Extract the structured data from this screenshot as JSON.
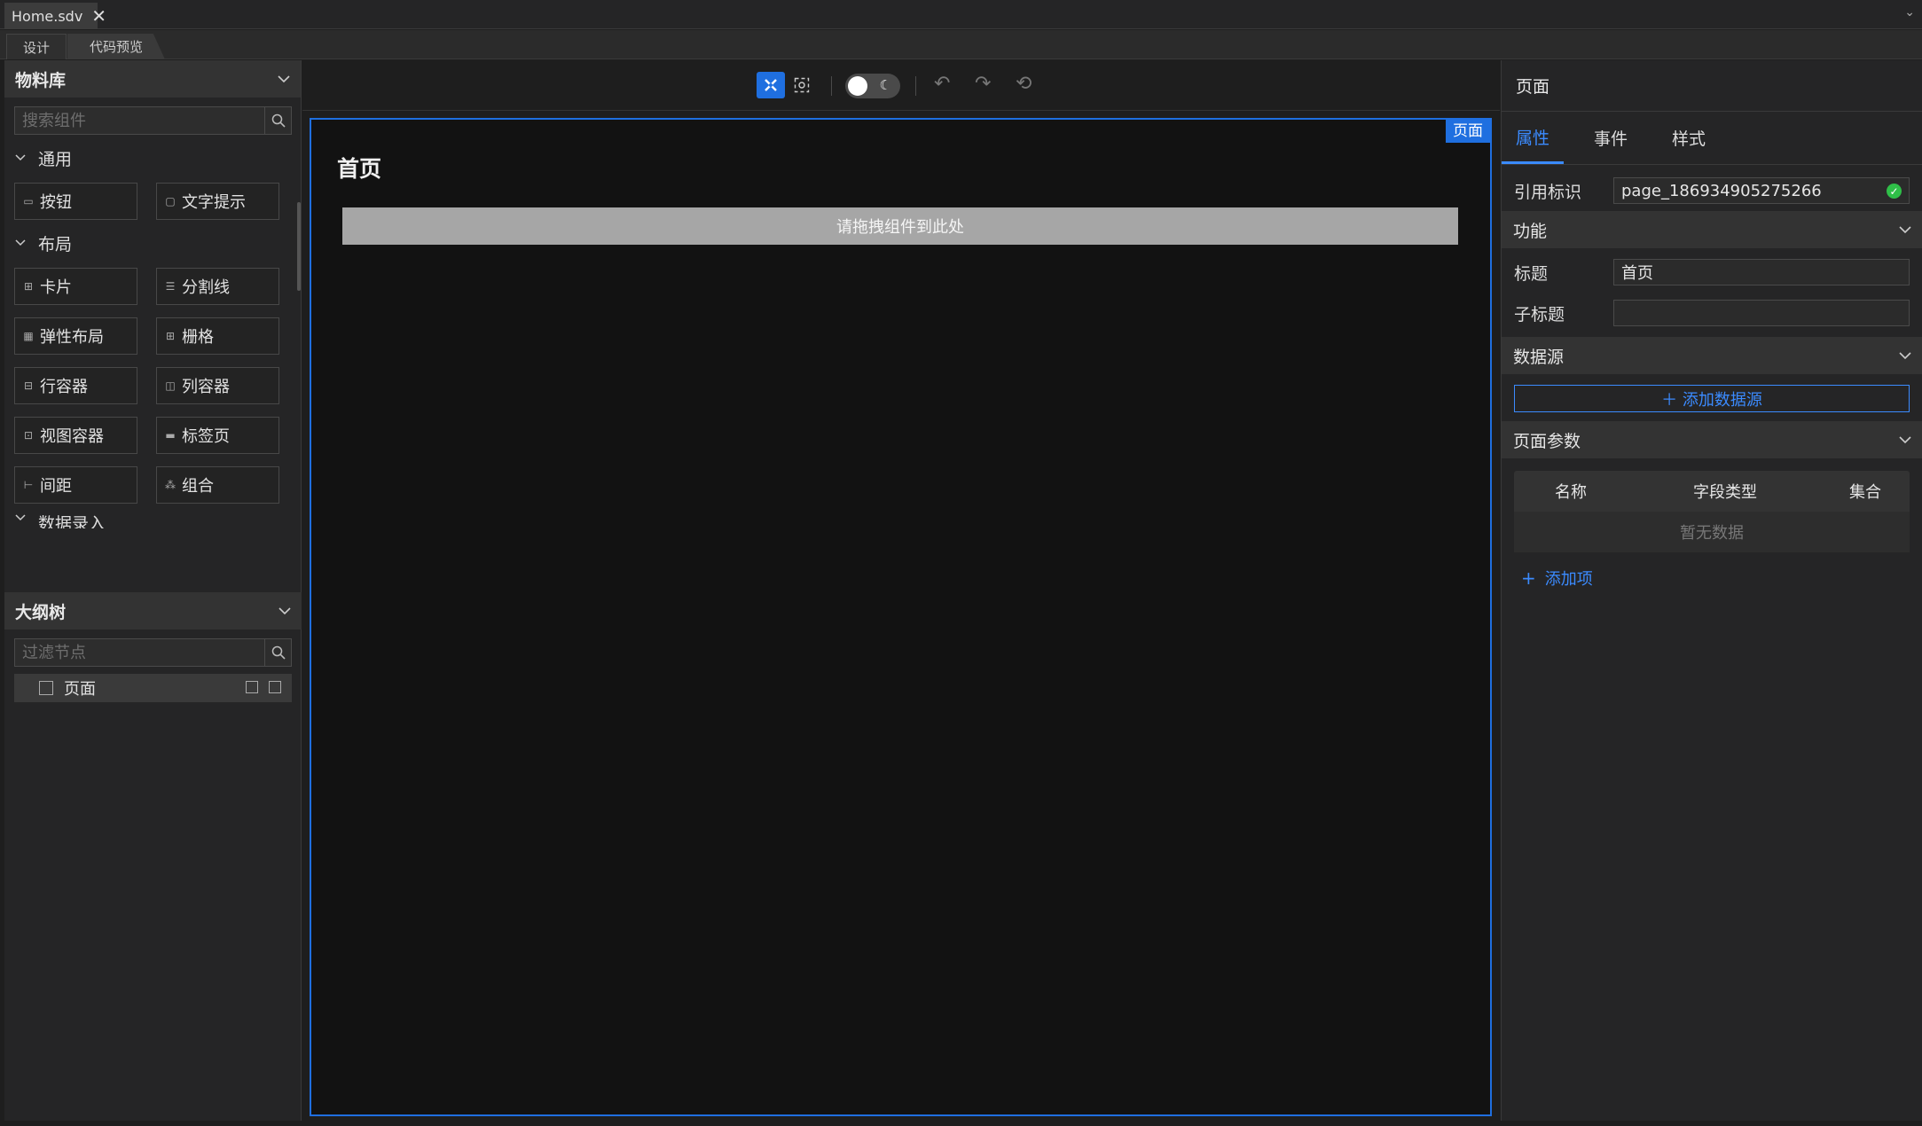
{
  "file_tab": {
    "name": "Home.sdv",
    "close": "✕"
  },
  "mode_tabs": [
    {
      "label": "设计"
    },
    {
      "label": "代码预览"
    }
  ],
  "library": {
    "title": "物料库",
    "search_placeholder": "搜索组件",
    "groups": [
      {
        "label": "通用",
        "items": [
          {
            "label": "按钮",
            "icon": "button-icon"
          },
          {
            "label": "文字提示",
            "icon": "tooltip-icon"
          }
        ]
      },
      {
        "label": "布局",
        "items": [
          {
            "label": "卡片",
            "icon": "card-icon"
          },
          {
            "label": "分割线",
            "icon": "divider-icon"
          },
          {
            "label": "弹性布局",
            "icon": "flex-icon"
          },
          {
            "label": "栅格",
            "icon": "grid-icon"
          },
          {
            "label": "行容器",
            "icon": "row-icon"
          },
          {
            "label": "列容器",
            "icon": "column-icon"
          },
          {
            "label": "视图容器",
            "icon": "view-icon"
          },
          {
            "label": "标签页",
            "icon": "tabs-icon"
          },
          {
            "label": "间距",
            "icon": "spacing-icon"
          },
          {
            "label": "组合",
            "icon": "group-icon"
          }
        ]
      },
      {
        "label": "数据录入"
      }
    ]
  },
  "outline": {
    "title": "大纲树",
    "search_placeholder": "过滤节点",
    "node": {
      "label": "页面"
    }
  },
  "canvas": {
    "badge": "页面",
    "page_title": "首页",
    "dropzone": "请拖拽组件到此处"
  },
  "props": {
    "title": "页面",
    "tabs": [
      {
        "label": "属性"
      },
      {
        "label": "事件"
      },
      {
        "label": "样式"
      }
    ],
    "ref_label": "引用标识",
    "ref_value": "page_186934905275266",
    "sections": {
      "func": "功能",
      "datasource": "数据源",
      "params": "页面参数"
    },
    "title_label": "标题",
    "title_value": "首页",
    "subtitle_label": "子标题",
    "subtitle_value": "",
    "add_datasource": "＋ 添加数据源",
    "params_table": {
      "headers": [
        "名称",
        "字段类型",
        "集合"
      ],
      "empty": "暂无数据"
    },
    "add_item": "添加项"
  },
  "colors": {
    "accent": "#1f6fe0",
    "link": "#3b8bff",
    "ok": "#2fbf48"
  }
}
